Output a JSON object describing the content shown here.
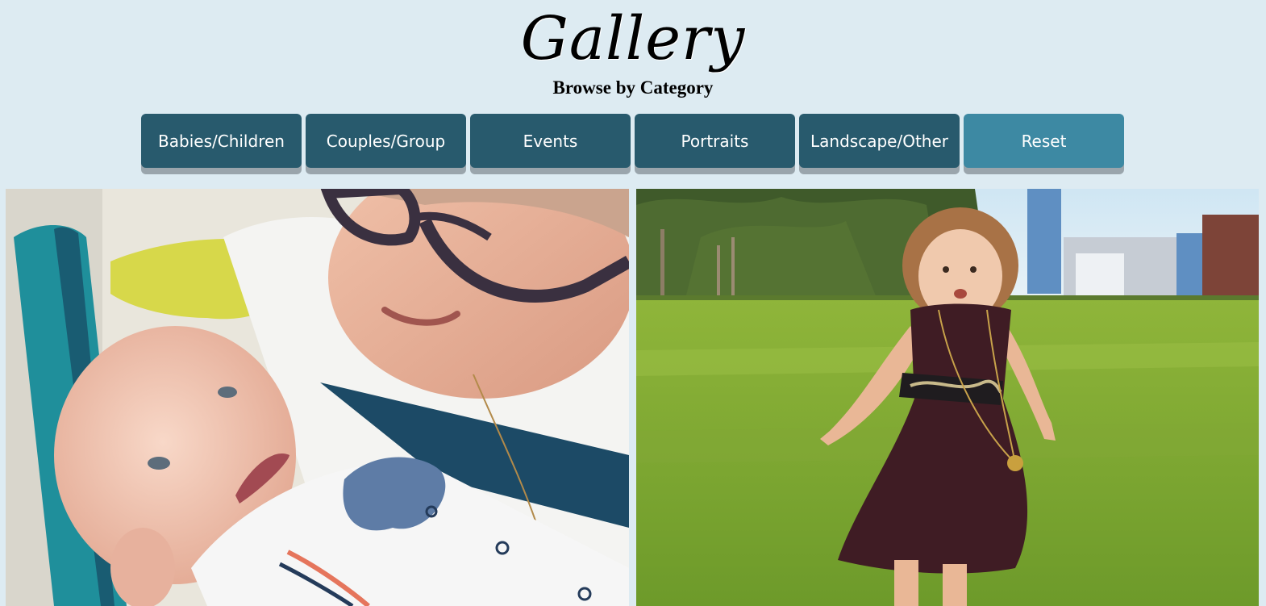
{
  "header": {
    "title": "Gallery",
    "subtitle": "Browse by Category"
  },
  "nav": {
    "buttons": [
      {
        "label": "Babies/Children"
      },
      {
        "label": "Couples/Group"
      },
      {
        "label": "Events"
      },
      {
        "label": "Portraits"
      },
      {
        "label": "Landscape/Other"
      },
      {
        "label": "Reset"
      }
    ]
  },
  "colors": {
    "background": "#ddebf2",
    "button": "#285a6d",
    "button_active": "#3d89a3",
    "button_shadow": "#9aa5ac"
  }
}
